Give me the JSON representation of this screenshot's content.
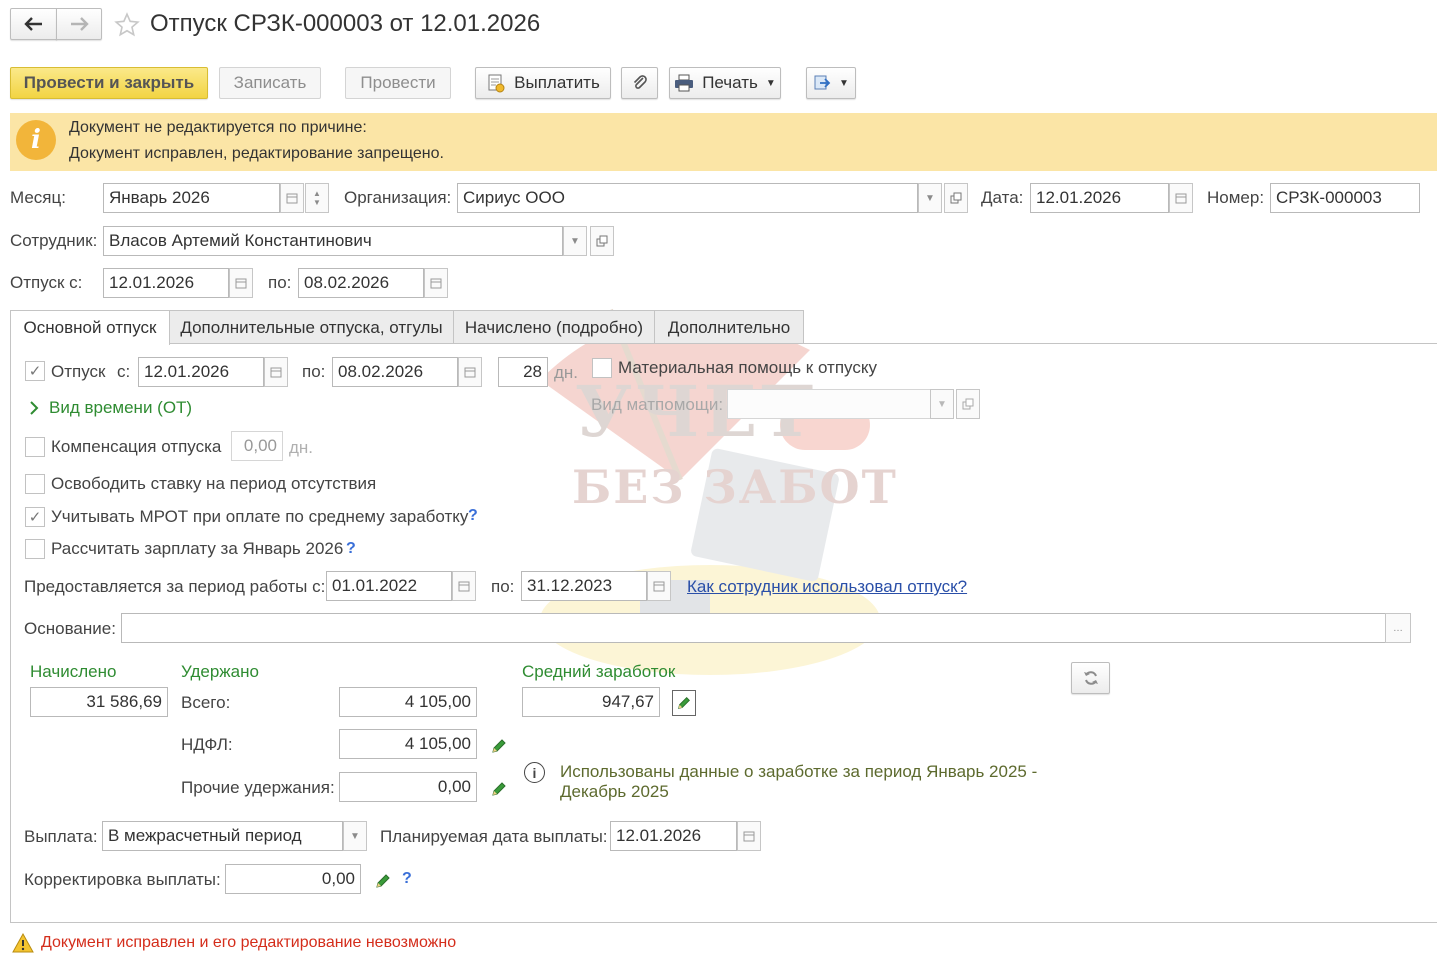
{
  "title": "Отпуск СРЗК-000003 от 12.01.2026",
  "toolbar": {
    "post_close": "Провести и закрыть",
    "save": "Записать",
    "post": "Провести",
    "pay": "Выплатить",
    "print": "Печать"
  },
  "notice": {
    "line1": "Документ не редактируется по причине:",
    "line2": "Документ исправлен, редактирование запрещено."
  },
  "header": {
    "month_label": "Месяц:",
    "month_value": "Январь 2026",
    "org_label": "Организация:",
    "org_value": "Сириус ООО",
    "date_label": "Дата:",
    "date_value": "12.01.2026",
    "number_label": "Номер:",
    "number_value": "СРЗК-000003",
    "employee_label": "Сотрудник:",
    "employee_value": "Власов Артемий Константинович",
    "vac_from_label": "Отпуск с:",
    "vac_from_value": "12.01.2026",
    "vac_to_label": "по:",
    "vac_to_value": "08.02.2026"
  },
  "tabs": [
    {
      "label": "Основной отпуск",
      "active": true
    },
    {
      "label": "Дополнительные отпуска, отгулы",
      "active": false
    },
    {
      "label": "Начислено (подробно)",
      "active": false
    },
    {
      "label": "Дополнительно",
      "active": false
    }
  ],
  "main": {
    "vacation_label": "Отпуск",
    "vacation_from_label": "с:",
    "vacation_from": "12.01.2026",
    "vacation_to_label": "по:",
    "vacation_to": "08.02.2026",
    "days": "28",
    "days_unit": "дн.",
    "material_aid_label": "Материальная помощь к отпуску",
    "material_aid_type_label": "Вид матпомощи:",
    "time_type_label": "Вид времени (ОТ)",
    "compensation_label": "Компенсация отпуска",
    "compensation_value": "0,00",
    "compensation_unit": "дн.",
    "free_rate_label": "Освободить ставку на период отсутствия",
    "mrot_label": "Учитывать МРОТ при оплате по среднему заработку",
    "calc_salary_label": "Рассчитать зарплату за Январь 2026",
    "work_period_label": "Предоставляется за период работы с:",
    "work_period_from": "01.01.2022",
    "work_period_to_label": "по:",
    "work_period_to": "31.12.2023",
    "used_link": "Как сотрудник использовал отпуск?",
    "basis_label": "Основание:",
    "basis_value": "",
    "accrued_header": "Начислено",
    "accrued_value": "31 586,69",
    "withheld_header": "Удержано",
    "total_label": "Всего:",
    "total_value": "4 105,00",
    "ndfl_label": "НДФЛ:",
    "ndfl_value": "4 105,00",
    "other_label": "Прочие удержания:",
    "other_value": "0,00",
    "avg_header": "Средний заработок",
    "avg_value": "947,67",
    "info_text_line1": "Использованы данные о заработке за период Январь 2025 -",
    "info_text_line2": "Декабрь 2025",
    "payment_label": "Выплата:",
    "payment_value": "В межрасчетный период",
    "planned_date_label": "Планируемая дата выплаты:",
    "planned_date_value": "12.01.2026",
    "correction_label": "Корректировка выплаты:",
    "correction_value": "0,00"
  },
  "watermark": {
    "line1": "УЧЕТ",
    "line2": "БЕЗ ЗАБОТ"
  },
  "footer_warning": "Документ исправлен и его редактирование невозможно",
  "colors": {
    "primary_button": "#f2d443",
    "notice_bg": "#fbe5a6",
    "green_headers": "#2f8c32",
    "link": "#2a4fa8",
    "warning_text": "#d42d1b"
  }
}
